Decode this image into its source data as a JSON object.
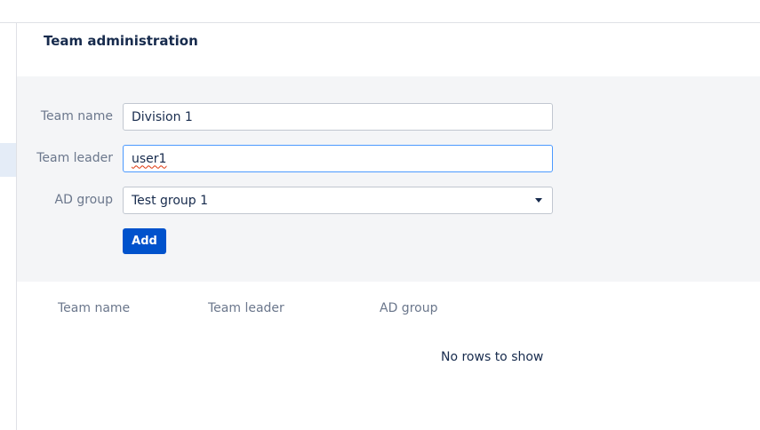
{
  "page": {
    "title": "Team administration"
  },
  "form": {
    "team_name": {
      "label": "Team name",
      "value": "Division 1"
    },
    "team_leader": {
      "label": "Team leader",
      "value": "user1"
    },
    "ad_group": {
      "label": "AD group",
      "value": "Test group 1"
    },
    "add_label": "Add"
  },
  "table": {
    "columns": [
      "Team name",
      "Team leader",
      "AD group"
    ],
    "rows": [],
    "empty_message": "No rows to show"
  },
  "colors": {
    "primary": "#0052cc",
    "focus_border": "#4c9aff",
    "panel_bg": "#f4f5f7",
    "label": "#6b778c",
    "text": "#172b4d"
  }
}
